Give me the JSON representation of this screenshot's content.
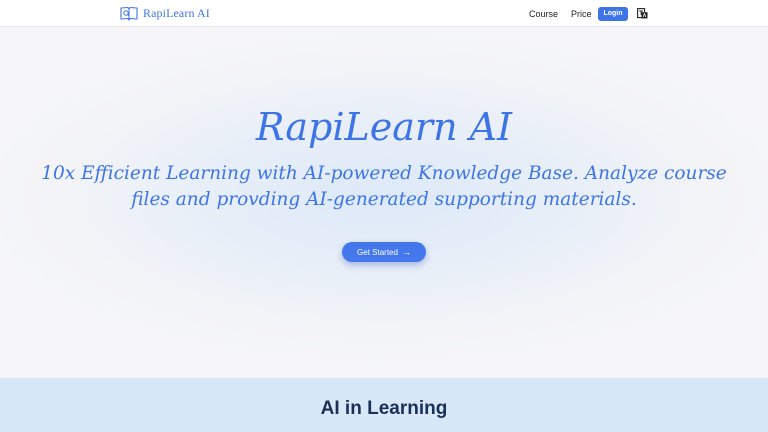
{
  "header": {
    "brand_name": "RapiLearn AI",
    "nav": {
      "course": "Course",
      "price": "Price"
    },
    "login_label": "Login"
  },
  "hero": {
    "title": "RapiLearn AI",
    "subtitle": "10x Efficient Learning with AI-powered Knowledge Base. Analyze course files and provding AI-generated supporting materials.",
    "cta_label": "Get Started",
    "cta_icon": "arrow-right-icon"
  },
  "section": {
    "title": "AI in Learning"
  },
  "colors": {
    "accent": "#3f74e8",
    "section_bg": "#d7e9f8",
    "heading_dark": "#1b2f57"
  },
  "icons": {
    "brand": "book-icon",
    "language": "translate-icon"
  }
}
